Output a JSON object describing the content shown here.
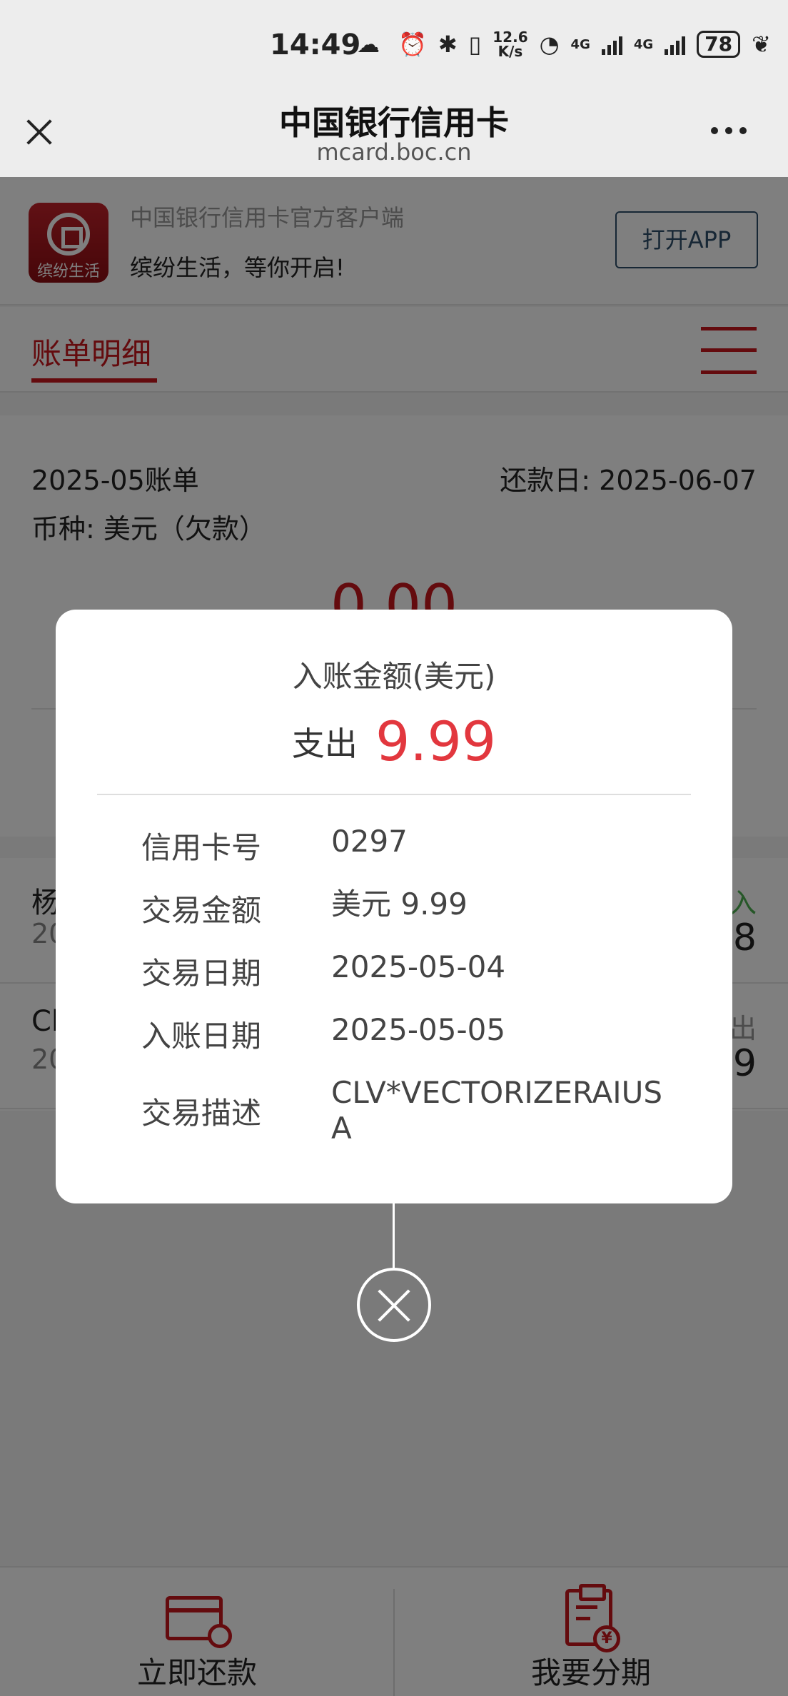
{
  "status_bar": {
    "time": "14:49",
    "net_speed_value": "12.6",
    "net_speed_unit": "K/s",
    "network_1": "4G",
    "network_2": "4G",
    "battery": "78"
  },
  "browser": {
    "title": "中国银行信用卡",
    "url": "mcard.boc.cn"
  },
  "app_banner": {
    "logo_text": "缤纷生活",
    "subtitle": "中国银行信用卡官方客户端",
    "tagline": "缤纷生活，等你开启!",
    "open_button": "打开APP"
  },
  "tabs": {
    "active": "账单明细"
  },
  "bill": {
    "month_label": "2025-05账单",
    "due_label": "还款日: 2025-06-07",
    "currency_label": "币种: 美元（欠款）",
    "amount": "0.00"
  },
  "transactions": [
    {
      "name": "杨",
      "date": "20",
      "type": "入",
      "type_color": "#4caf50",
      "amount": "8"
    },
    {
      "name": "Cl",
      "date": "20",
      "type": "出",
      "type_color": "#999999",
      "amount": "9"
    }
  ],
  "bottom_bar": {
    "repay_label": "立即还款",
    "installment_label": "我要分期"
  },
  "modal": {
    "title": "入账金额(美元)",
    "type": "支出",
    "amount": "9.99",
    "amount_color": "#e2373e",
    "details": [
      {
        "label": "信用卡号",
        "value": "0297"
      },
      {
        "label": "交易金额",
        "value": "美元 9.99"
      },
      {
        "label": "交易日期",
        "value": "2025-05-04"
      },
      {
        "label": "入账日期",
        "value": "2025-05-05"
      },
      {
        "label": "交易描述",
        "value": "CLV*VECTORIZERAIUSA"
      }
    ]
  },
  "icons": {
    "close": "close-icon",
    "more": "more-icon",
    "menu": "menu-icon",
    "repay": "card-repay-icon",
    "installment": "installment-icon",
    "modal_close": "close-circle-icon"
  }
}
